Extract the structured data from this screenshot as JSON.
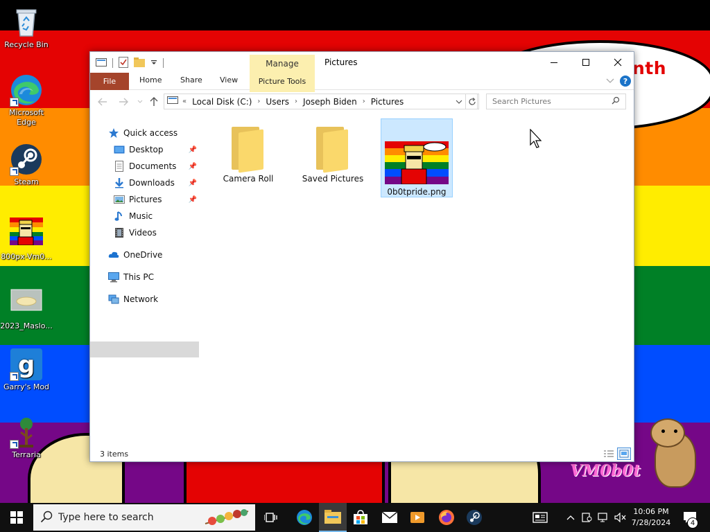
{
  "desktop": {
    "wallpaper_text": "nth",
    "watermark": "VM0b0t",
    "icons": [
      {
        "label": "Recycle Bin"
      },
      {
        "label": "Microsoft Edge"
      },
      {
        "label": "Steam"
      },
      {
        "label": "800px-Vm0..."
      },
      {
        "label": "2023_Maslo..."
      },
      {
        "label": "Garry's Mod"
      },
      {
        "label": "Terraria"
      }
    ]
  },
  "window": {
    "title": "Pictures",
    "manage_label": "Manage",
    "ribbon_tabs": {
      "file": "File",
      "home": "Home",
      "share": "Share",
      "view": "View",
      "picture_tools": "Picture Tools"
    },
    "address": {
      "overflow": "«",
      "crumbs": [
        "Local Disk (C:)",
        "Users",
        "Joseph Biden",
        "Pictures"
      ]
    },
    "search_placeholder": "Search Pictures",
    "nav": {
      "quick_access": "Quick access",
      "desktop": "Desktop",
      "documents": "Documents",
      "downloads": "Downloads",
      "pictures": "Pictures",
      "music": "Music",
      "videos": "Videos",
      "onedrive": "OneDrive",
      "this_pc": "This PC",
      "network": "Network"
    },
    "files": [
      {
        "name": "Camera Roll"
      },
      {
        "name": "Saved Pictures"
      },
      {
        "name": "0b0tpride.png"
      }
    ],
    "status": "3 items"
  },
  "taskbar": {
    "search_placeholder": "Type here to search",
    "clock_time": "10:06 PM",
    "clock_date": "7/28/2024",
    "notifications": "4"
  },
  "colors": {
    "file_tab": "#a5442b",
    "manage_tab": "#fcefaf",
    "selection": "#cce8ff",
    "accent": "#1a73c8"
  }
}
